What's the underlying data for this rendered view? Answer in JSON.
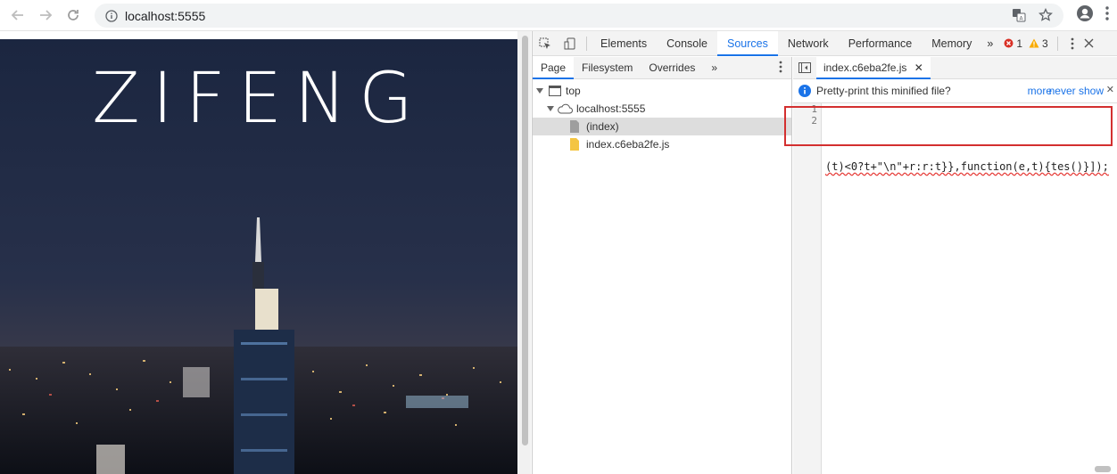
{
  "browser": {
    "url": "localhost:5555"
  },
  "page": {
    "title": "ZIFENG"
  },
  "devtools": {
    "tabs": [
      "Elements",
      "Console",
      "Sources",
      "Network",
      "Performance",
      "Memory"
    ],
    "active_tab": "Sources",
    "more_tabs": "»",
    "error_count": "1",
    "warning_count": "3",
    "navigator": {
      "tabs": [
        "Page",
        "Filesystem",
        "Overrides"
      ],
      "more": "»",
      "tree": [
        {
          "label": "top",
          "level": 0
        },
        {
          "label": "localhost:5555",
          "level": 1
        },
        {
          "label": "(index)",
          "level": 2,
          "selected": true
        },
        {
          "label": "index.c6eba2fe.js",
          "level": 2
        }
      ]
    },
    "editor": {
      "file_tab": "index.c6eba2fe.js",
      "infobar_text": "Pretty-print this minified file?",
      "infobar_more": "more",
      "infobar_never": "never show",
      "line_numbers": [
        "1",
        "2"
      ],
      "lines": [
        "",
        "(t)<0?t+\"\\n\"+r:r:t}},function(e,t){tes()}]);"
      ]
    }
  },
  "colors": {
    "accent": "#1a73e8",
    "error": "#d93025",
    "warning": "#f9ab00",
    "highlight": "#d32f2f"
  }
}
